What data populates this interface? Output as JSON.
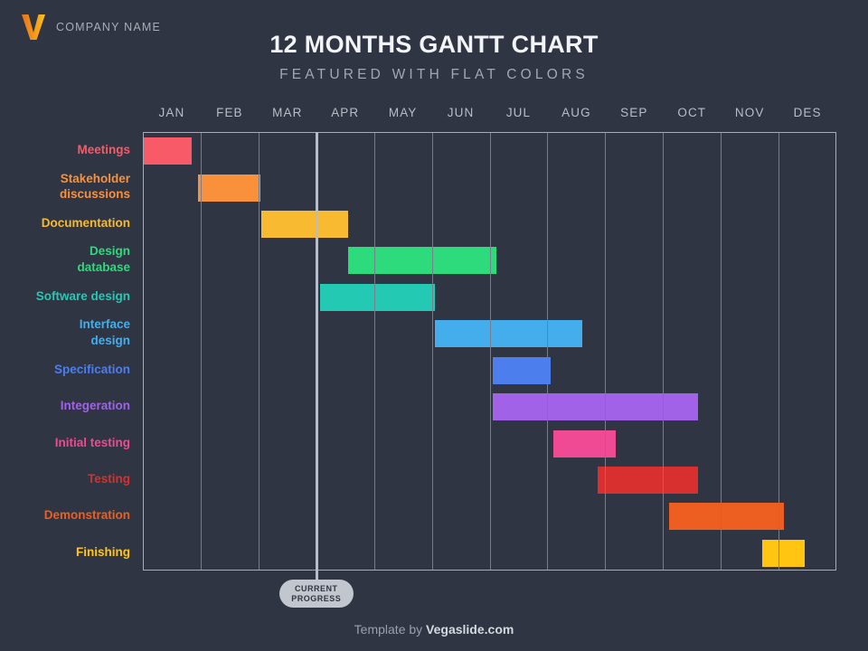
{
  "brand": {
    "company_name": "COMPANY NAME",
    "logo_icon": "v-logo-icon",
    "logo_color_left": "#e8721c",
    "logo_color_right": "#fbbf24"
  },
  "header": {
    "title": "12 MONTHS GANTT CHART",
    "subtitle": "FEATURED WITH FLAT COLORS"
  },
  "current_progress": {
    "line1": "CURRENT",
    "line2": "PROGRESS",
    "month_position": 3.0,
    "pill_color": "#c2c6cf"
  },
  "footer": {
    "prefix": "Template by ",
    "brand": "Vegaslide.com"
  },
  "chart_data": {
    "type": "bar",
    "title": "12 MONTHS GANTT CHART",
    "subtitle": "FEATURED WITH FLAT COLORS",
    "orientation": "horizontal",
    "xlabel": "",
    "ylabel": "",
    "grid": true,
    "legend": "none",
    "xlim": [
      0,
      12
    ],
    "categories": [
      "JAN",
      "FEB",
      "MAR",
      "APR",
      "MAY",
      "JUN",
      "JUL",
      "AUG",
      "SEP",
      "OCT",
      "NOV",
      "DES"
    ],
    "tasks": [
      {
        "label": "Meetings",
        "start": 0.0,
        "end": 0.85,
        "color": "#f95a68"
      },
      {
        "label": "Stakeholder\ndiscussions",
        "start": 0.95,
        "end": 2.03,
        "color": "#f9913c"
      },
      {
        "label": "Documentation",
        "start": 2.05,
        "end": 3.55,
        "color": "#f7ba30"
      },
      {
        "label": "Design\ndatabase",
        "start": 3.55,
        "end": 6.12,
        "color": "#2ddb7c"
      },
      {
        "label": "Software design",
        "start": 3.07,
        "end": 5.06,
        "color": "#24c9b4"
      },
      {
        "label": "Interface\ndesign",
        "start": 5.06,
        "end": 7.6,
        "color": "#44aeec"
      },
      {
        "label": "Specification",
        "start": 6.05,
        "end": 7.06,
        "color": "#4d7eed"
      },
      {
        "label": "Integeration",
        "start": 6.05,
        "end": 9.6,
        "color": "#a162e8"
      },
      {
        "label": "Initial testing",
        "start": 7.1,
        "end": 8.18,
        "color": "#ef4a93"
      },
      {
        "label": "Testing",
        "start": 7.87,
        "end": 9.6,
        "color": "#d8302e"
      },
      {
        "label": "Demonstration",
        "start": 9.1,
        "end": 11.1,
        "color": "#ed5f21"
      },
      {
        "label": "Finishing",
        "start": 10.72,
        "end": 11.46,
        "color": "#ffc511"
      }
    ]
  }
}
